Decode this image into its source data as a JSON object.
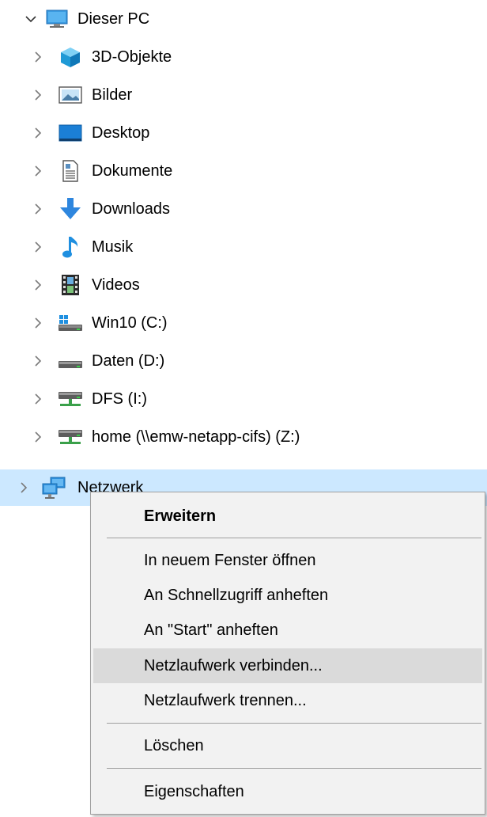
{
  "tree": {
    "root": {
      "label": "Dieser PC",
      "icon": "computer-icon",
      "expanded": true
    },
    "children": [
      {
        "label": "3D-Objekte",
        "icon": "3d-objects-icon"
      },
      {
        "label": "Bilder",
        "icon": "pictures-icon"
      },
      {
        "label": "Desktop",
        "icon": "desktop-icon"
      },
      {
        "label": "Dokumente",
        "icon": "documents-icon"
      },
      {
        "label": "Downloads",
        "icon": "downloads-icon"
      },
      {
        "label": "Musik",
        "icon": "music-icon"
      },
      {
        "label": "Videos",
        "icon": "videos-icon"
      },
      {
        "label": "Win10 (C:)",
        "icon": "system-drive-icon"
      },
      {
        "label": "Daten (D:)",
        "icon": "drive-icon"
      },
      {
        "label": "DFS (I:)",
        "icon": "network-drive-icon"
      },
      {
        "label": "home (\\\\emw-netapp-cifs) (Z:)",
        "icon": "network-drive-icon"
      }
    ],
    "network": {
      "label": "Netzwerk",
      "icon": "network-icon",
      "selected": true
    }
  },
  "context_menu": {
    "items": [
      {
        "label": "Erweitern",
        "bold": true
      },
      {
        "label": "In neuem Fenster öffnen"
      },
      {
        "label": "An Schnellzugriff anheften"
      },
      {
        "label": "An \"Start\" anheften"
      },
      {
        "label": "Netzlaufwerk verbinden...",
        "hovered": true
      },
      {
        "label": "Netzlaufwerk trennen..."
      },
      {
        "label": "Löschen"
      },
      {
        "label": "Eigenschaften"
      }
    ],
    "colors": {
      "background": "#f2f2f2",
      "hover": "#dadada",
      "border": "#a0a0a0"
    }
  },
  "colors": {
    "selection": "#cce8ff",
    "chevron": "#7a7a7a"
  }
}
